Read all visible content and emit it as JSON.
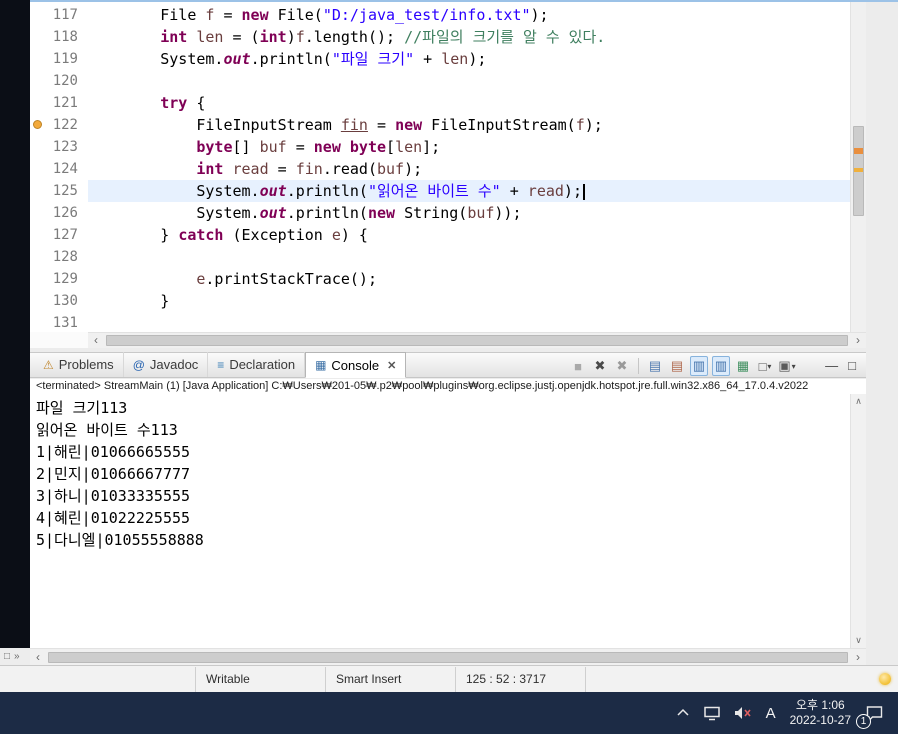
{
  "editor": {
    "current_line": "125",
    "gutter_marker_line": "122",
    "lines": [
      {
        "n": "117",
        "tokens": [
          {
            "t": "        File ",
            "c": "p"
          },
          {
            "t": "f",
            "c": "v"
          },
          {
            "t": " = ",
            "c": "p"
          },
          {
            "t": "new",
            "c": "k"
          },
          {
            "t": " File(",
            "c": "p"
          },
          {
            "t": "\"D:/java_test/info.txt\"",
            "c": "s"
          },
          {
            "t": ");",
            "c": "p"
          }
        ]
      },
      {
        "n": "118",
        "tokens": [
          {
            "t": "        ",
            "c": "p"
          },
          {
            "t": "int",
            "c": "k"
          },
          {
            "t": " ",
            "c": "p"
          },
          {
            "t": "len",
            "c": "v"
          },
          {
            "t": " = (",
            "c": "p"
          },
          {
            "t": "int",
            "c": "k"
          },
          {
            "t": ")",
            "c": "p"
          },
          {
            "t": "f",
            "c": "v"
          },
          {
            "t": ".length(); ",
            "c": "p"
          },
          {
            "t": "//파일의 크기를 알 수 있다.",
            "c": "c"
          }
        ]
      },
      {
        "n": "119",
        "tokens": [
          {
            "t": "        System.",
            "c": "p"
          },
          {
            "t": "out",
            "c": "st"
          },
          {
            "t": ".println(",
            "c": "p"
          },
          {
            "t": "\"파일 크기\"",
            "c": "s"
          },
          {
            "t": " + ",
            "c": "p"
          },
          {
            "t": "len",
            "c": "v"
          },
          {
            "t": ");",
            "c": "p"
          }
        ]
      },
      {
        "n": "120",
        "tokens": []
      },
      {
        "n": "121",
        "tokens": [
          {
            "t": "        ",
            "c": "p"
          },
          {
            "t": "try",
            "c": "k"
          },
          {
            "t": " {",
            "c": "p"
          }
        ]
      },
      {
        "n": "122",
        "tokens": [
          {
            "t": "            FileInputStream ",
            "c": "p"
          },
          {
            "t": "fin",
            "c": "v u"
          },
          {
            "t": " = ",
            "c": "p"
          },
          {
            "t": "new",
            "c": "k"
          },
          {
            "t": " FileInputStream(",
            "c": "p"
          },
          {
            "t": "f",
            "c": "v"
          },
          {
            "t": ");",
            "c": "p"
          }
        ]
      },
      {
        "n": "123",
        "tokens": [
          {
            "t": "            ",
            "c": "p"
          },
          {
            "t": "byte",
            "c": "k"
          },
          {
            "t": "[] ",
            "c": "p"
          },
          {
            "t": "buf",
            "c": "v"
          },
          {
            "t": " = ",
            "c": "p"
          },
          {
            "t": "new",
            "c": "k"
          },
          {
            "t": " ",
            "c": "p"
          },
          {
            "t": "byte",
            "c": "k"
          },
          {
            "t": "[",
            "c": "p"
          },
          {
            "t": "len",
            "c": "v"
          },
          {
            "t": "];",
            "c": "p"
          }
        ]
      },
      {
        "n": "124",
        "tokens": [
          {
            "t": "            ",
            "c": "p"
          },
          {
            "t": "int",
            "c": "k"
          },
          {
            "t": " ",
            "c": "p"
          },
          {
            "t": "read",
            "c": "v"
          },
          {
            "t": " = ",
            "c": "p"
          },
          {
            "t": "fin",
            "c": "v"
          },
          {
            "t": ".read(",
            "c": "p"
          },
          {
            "t": "buf",
            "c": "v"
          },
          {
            "t": ");",
            "c": "p"
          }
        ]
      },
      {
        "n": "125",
        "caret": true,
        "tokens": [
          {
            "t": "            System.",
            "c": "p"
          },
          {
            "t": "out",
            "c": "st"
          },
          {
            "t": ".println(",
            "c": "p"
          },
          {
            "t": "\"읽어온 바이트 수\"",
            "c": "s"
          },
          {
            "t": " + ",
            "c": "p"
          },
          {
            "t": "read",
            "c": "v"
          },
          {
            "t": ");",
            "c": "p"
          }
        ]
      },
      {
        "n": "126",
        "tokens": [
          {
            "t": "            System.",
            "c": "p"
          },
          {
            "t": "out",
            "c": "st"
          },
          {
            "t": ".println(",
            "c": "p"
          },
          {
            "t": "new",
            "c": "k"
          },
          {
            "t": " String(",
            "c": "p"
          },
          {
            "t": "buf",
            "c": "v"
          },
          {
            "t": "));",
            "c": "p"
          }
        ]
      },
      {
        "n": "127",
        "tokens": [
          {
            "t": "        } ",
            "c": "p"
          },
          {
            "t": "catch",
            "c": "k"
          },
          {
            "t": " (Exception ",
            "c": "p"
          },
          {
            "t": "e",
            "c": "v"
          },
          {
            "t": ") {",
            "c": "p"
          }
        ]
      },
      {
        "n": "128",
        "tokens": []
      },
      {
        "n": "129",
        "tokens": [
          {
            "t": "            ",
            "c": "p"
          },
          {
            "t": "e",
            "c": "v"
          },
          {
            "t": ".printStackTrace();",
            "c": "p"
          }
        ]
      },
      {
        "n": "130",
        "tokens": [
          {
            "t": "        }",
            "c": "p"
          }
        ]
      },
      {
        "n": "131",
        "tokens": []
      }
    ]
  },
  "views": {
    "tabs": [
      {
        "label": "Problems",
        "icon": "problems-icon",
        "glyph": "⚠",
        "color": "#c0872f",
        "active": false
      },
      {
        "label": "Javadoc",
        "icon": "javadoc-icon",
        "glyph": "@",
        "color": "#2864b0",
        "active": false
      },
      {
        "label": "Declaration",
        "icon": "declaration-icon",
        "glyph": "≡",
        "color": "#3a7fb5",
        "active": false
      },
      {
        "label": "Console",
        "icon": "console-icon",
        "glyph": "▦",
        "color": "#3a6fa5",
        "active": true,
        "close": "✕"
      }
    ],
    "toolbar": [
      {
        "name": "terminate-icon",
        "glyph": "■",
        "color": "#a9a9a9"
      },
      {
        "name": "remove-launch-icon",
        "glyph": "✖",
        "color": "#4a4a4a"
      },
      {
        "name": "remove-all-launches-icon",
        "glyph": "✖",
        "color": "#9a9a9a"
      },
      {
        "sep": true
      },
      {
        "name": "show-console-on-output-icon",
        "glyph": "▤",
        "color": "#4f7ab0"
      },
      {
        "name": "show-console-on-error-icon",
        "glyph": "▤",
        "color": "#b06a4f"
      },
      {
        "name": "word-wrap-icon",
        "glyph": "▥",
        "color": "#3f6fa8",
        "pressed": true
      },
      {
        "name": "scroll-lock-icon",
        "glyph": "▥",
        "color": "#3f6fa8",
        "pressed": true
      },
      {
        "name": "pin-console-icon",
        "glyph": "▦",
        "color": "#3f8f5f"
      },
      {
        "name": "display-selected-console-icon",
        "glyph": "□",
        "color": "#5a5a5a",
        "dropdown": true
      },
      {
        "name": "open-console-icon",
        "glyph": "▣",
        "color": "#5a5a5a",
        "dropdown": true
      }
    ],
    "dropdown_glyph": "▾",
    "minimize_glyph": "—",
    "maximize_glyph": "□"
  },
  "console": {
    "header": "<terminated> StreamMain (1) [Java Application] C:₩Users₩201-05₩.p2₩pool₩plugins₩org.eclipse.justj.openjdk.hotspot.jre.full.win32.x86_64_17.0.4.v2022",
    "output": [
      "파일 크기113",
      "읽어온 바이트 수113",
      "1|해린|01066665555",
      "2|민지|01066667777",
      "3|하니|01033335555",
      "4|혜린|01022225555",
      "5|다니엘|01055558888"
    ]
  },
  "statusbar": {
    "writable": "Writable",
    "smart_insert": "Smart Insert",
    "caret_position": "125 : 52 : 3717"
  },
  "taskbar": {
    "ime": "A",
    "time": "오후 1:06",
    "date": "2022-10-27",
    "badge": "1"
  },
  "scroll": {
    "left": "‹",
    "right": "›",
    "up": "∧",
    "down": "∨"
  },
  "trim": {
    "restore": "□",
    "expand": "»"
  }
}
